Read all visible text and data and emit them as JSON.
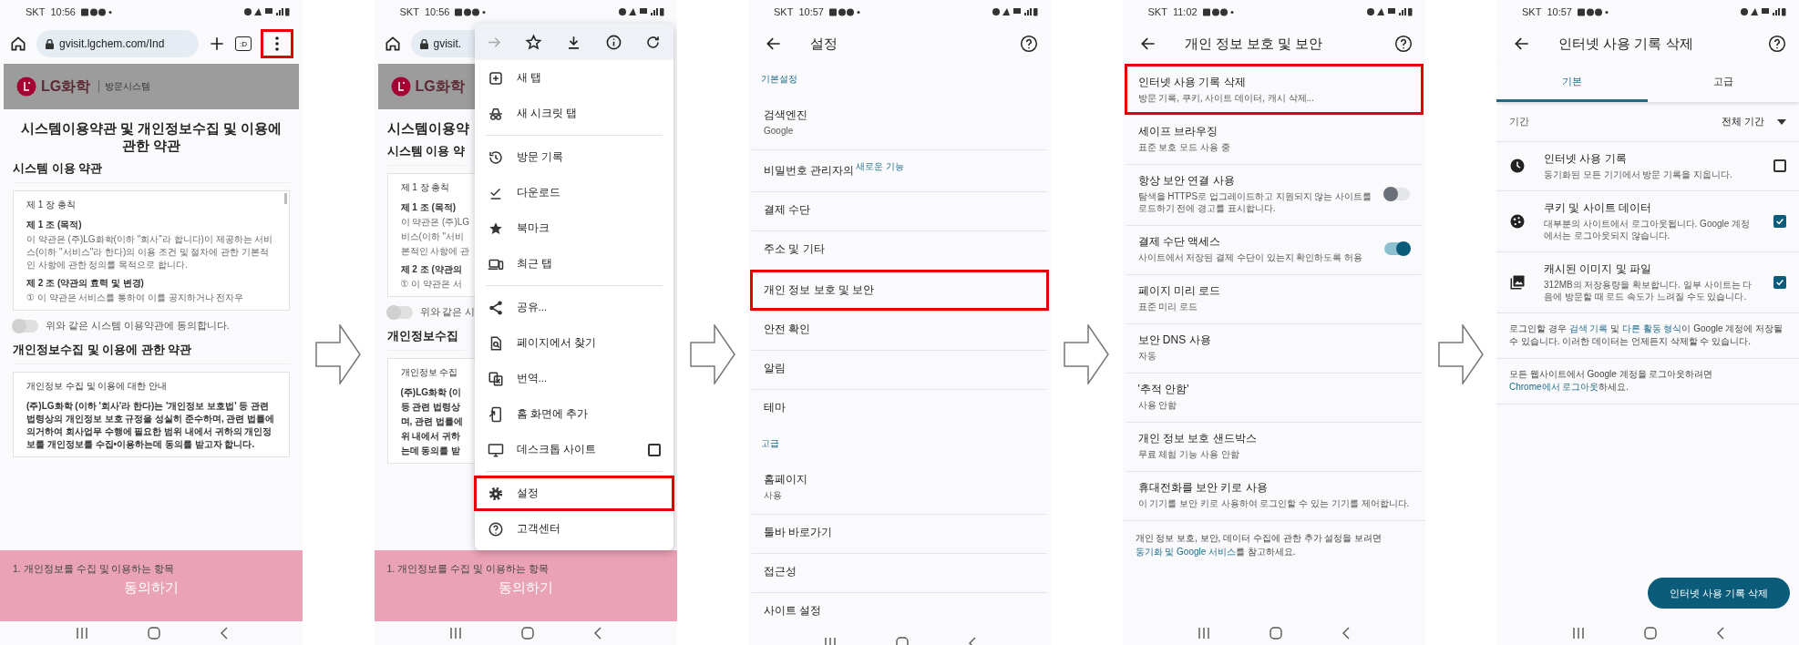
{
  "screens": {
    "web_page": {
      "carrier": "SKT",
      "time": "10:56",
      "url": "gvisit.lgchem.com/Ind",
      "tab_switcher": ":D",
      "menu_button_highlighted": true,
      "logo": "LG화학",
      "system_name": "방문시스템",
      "title": "시스템이용약관 및 개인정보수집 및 이용에 관한 약관",
      "section": "시스템 이용 약관",
      "terms_box": [
        {
          "kind": "heading",
          "text": "제 1 장 총칙"
        },
        {
          "kind": "bold",
          "text": "제 1 조 (목적)"
        },
        {
          "kind": "text",
          "text": "이 약관은 (주)LG화학(이하 \"회사\"라 합니다)이 제공하는 서비스(이하 \"서비스\"라 한다)의 이용 조건 및 절차에 관한 기본적인 사항에 관한 정의를 목적으로 합니다."
        },
        {
          "kind": "bold",
          "text": "제 2 조 (약관의 효력 및 변경)"
        },
        {
          "kind": "text",
          "text": "① 이 약관은 서비스를 통하여 이를 공지하거나 전자우"
        }
      ],
      "agree_toggle": {
        "label": "위와 같은 시스템 이용약관에 동의합니다.",
        "on": false
      },
      "section_2": "개인정보수집 및 이용에 관한 약관",
      "privacy_box": [
        {
          "kind": "heading",
          "text": "개인정보 수집 및 이용에 대한 안내"
        },
        {
          "kind": "strong",
          "text": "(주)LG화학 (이하 '회사'라 한다)는 '개인정보 보호법' 등 관련 법령상의 개인정보 보호 규정을 성실히 준수하며, 관련 법률에 의거하여 회사업무 수행에 필요한 범위 내에서 귀하의 개인정보를 개인정보를 수집•이용하는데 동의를 받고자 합니다."
        }
      ],
      "item_under_bar": "1. 개인정보를 수집 및 이용하는 항목",
      "agree_button": "동의하기"
    },
    "chrome_menu": {
      "carrier": "SKT",
      "time": "10:56",
      "page_behind": {
        "url": "gvisit.",
        "logo": "LG화학",
        "title": "시스템이용약",
        "section": "시스템 이용 약",
        "terms_box": [
          {
            "kind": "heading",
            "text": "제 1 장 총칙"
          },
          {
            "kind": "bold",
            "text": "제 1 조 (목적)"
          },
          {
            "kind": "text",
            "text": "이 약관은 (주)LG"
          },
          {
            "kind": "text",
            "text": "비스(이하 \"서비"
          },
          {
            "kind": "text",
            "text": "본적인 사항에 관"
          },
          {
            "kind": "bold",
            "text": "제 2 조 (약관의"
          },
          {
            "kind": "text",
            "text": "① 이 약관은 서"
          }
        ],
        "agree_toggle": {
          "label": "위와 같은 시",
          "on": false
        },
        "section_2": "개인정보수집",
        "privacy_box": [
          {
            "kind": "heading",
            "text": "개인정보 수집"
          },
          {
            "kind": "strong",
            "text": "(주)LG화학 (이"
          },
          {
            "kind": "strong",
            "text": "등 관련 법령상"
          },
          {
            "kind": "strong",
            "text": "며, 관련 법률에"
          },
          {
            "kind": "strong",
            "text": "위 내에서 귀하"
          },
          {
            "kind": "strong",
            "text": "는데 동의를 받"
          }
        ],
        "item_under_bar": "1. 개인정보를 수집 및 이용하는 항목",
        "agree_button": "동의하기"
      },
      "toolbar": [
        {
          "kind": "forward",
          "disabled": true
        },
        {
          "kind": "star",
          "disabled": false
        },
        {
          "kind": "download",
          "disabled": false
        },
        {
          "kind": "info",
          "disabled": false
        },
        {
          "kind": "refresh",
          "disabled": false
        }
      ],
      "groups": [
        [
          {
            "kind": "new-tab",
            "label": "새 탭",
            "highlighted": false
          },
          {
            "kind": "incognito",
            "label": "새 시크릿 탭",
            "highlighted": false
          }
        ],
        [
          {
            "kind": "history",
            "label": "방문 기록",
            "highlighted": false
          },
          {
            "kind": "downloads",
            "label": "다운로드",
            "highlighted": false
          },
          {
            "kind": "bookmarks",
            "label": "북마크",
            "highlighted": false
          },
          {
            "kind": "recent-tabs",
            "label": "최근 탭",
            "highlighted": false
          }
        ],
        [
          {
            "kind": "share",
            "label": "공유...",
            "highlighted": false
          },
          {
            "kind": "find",
            "label": "페이지에서 찾기",
            "highlighted": false
          },
          {
            "kind": "translate",
            "label": "번역...",
            "highlighted": false
          },
          {
            "kind": "add-home",
            "label": "홈 화면에 추가",
            "highlighted": false
          },
          {
            "kind": "desktop",
            "label": "데스크톱 사이트",
            "highlighted": false,
            "checked": false
          }
        ],
        [
          {
            "kind": "settings",
            "label": "설정",
            "highlighted": true
          },
          {
            "kind": "help",
            "label": "고객센터",
            "highlighted": false
          }
        ]
      ]
    },
    "settings": {
      "carrier": "SKT",
      "time": "10:57",
      "title": "설정",
      "rows": [
        {
          "kind": "section",
          "title": "기본설정"
        },
        {
          "kind": "item",
          "title": "검색엔진",
          "subtitle": "Google",
          "highlighted": false
        },
        {
          "kind": "item",
          "title": "비밀번호 관리자의",
          "badge": "새로운 기능",
          "highlighted": false
        },
        {
          "kind": "item",
          "title": "결제 수단",
          "highlighted": false
        },
        {
          "kind": "item",
          "title": "주소 및 기타",
          "highlighted": false
        },
        {
          "kind": "item",
          "title": "개인 정보 보호 및 보안",
          "highlighted": true
        },
        {
          "kind": "item",
          "title": "안전 확인",
          "highlighted": false
        },
        {
          "kind": "item",
          "title": "알림",
          "highlighted": false
        },
        {
          "kind": "item",
          "title": "테마",
          "highlighted": false
        },
        {
          "kind": "section",
          "title": "고급"
        },
        {
          "kind": "item",
          "title": "홈페이지",
          "subtitle": "사용",
          "highlighted": false
        },
        {
          "kind": "item",
          "title": "툴바 바로가기",
          "highlighted": false
        },
        {
          "kind": "item",
          "title": "접근성",
          "highlighted": false
        },
        {
          "kind": "item",
          "title": "사이트 설정",
          "highlighted": false
        }
      ]
    },
    "privacy_security": {
      "carrier": "SKT",
      "time": "11:02",
      "title": "개인 정보 보호 및 보안",
      "rows": [
        {
          "kind": "link",
          "title": "인터넷 사용 기록 삭제",
          "subtitle": "방문 기록, 쿠키, 사이트 데이터, 캐시 삭제...",
          "highlighted": true
        },
        {
          "kind": "link",
          "title": "세이프 브라우징",
          "subtitle": "표준 보호 모드 사용 중",
          "highlighted": false
        },
        {
          "kind": "switch",
          "title": "항상 보안 연결 사용",
          "subtitle": "탐색을 HTTPS로 업그레이드하고 지원되지 않는 사이트를 로드하기 전에 경고를 표시합니다.",
          "highlighted": false,
          "on": false
        },
        {
          "kind": "switch",
          "title": "결제 수단 액세스",
          "subtitle": "사이트에서 저장된 결제 수단이 있는지 확인하도록 허용",
          "highlighted": false,
          "on": true
        },
        {
          "kind": "link",
          "title": "페이지 미리 로드",
          "subtitle": "표준 미리 로드",
          "highlighted": false
        },
        {
          "kind": "link",
          "title": "보안 DNS 사용",
          "subtitle": "자동",
          "highlighted": false
        },
        {
          "kind": "link",
          "title": "'추적 안함'",
          "subtitle": "사용 안함",
          "highlighted": false
        },
        {
          "kind": "link",
          "title": "개인 정보 보호 샌드박스",
          "subtitle": "무료 체험 기능 사용 안함",
          "highlighted": false
        },
        {
          "kind": "link",
          "title": "휴대전화를 보안 키로 사용",
          "subtitle": "이 기기를 보안 키로 사용하여 로그인할 수 있는 기기를 제어합니다.",
          "highlighted": false
        }
      ],
      "footer": [
        {
          "text": "개인 정보 보호, 보안, 데이터 수집에 관한 추가 설정을 보려면 ",
          "link": false
        },
        {
          "text": "동기화 및 Google 서비스",
          "link": true
        },
        {
          "text": "를 참고하세요.",
          "link": false
        }
      ]
    },
    "clear_browsing_data": {
      "carrier": "SKT",
      "time": "10:57",
      "title": "인터넷 사용 기록 삭제",
      "tabs": [
        {
          "label": "기본",
          "selected": true
        },
        {
          "label": "고급",
          "selected": false
        }
      ],
      "time_range": {
        "label": "기간",
        "value": "전체 기간"
      },
      "options": [
        {
          "kind": "clock",
          "title": "인터넷 사용 기록",
          "description": "동기화된 모든 기기에서 방문 기록을 지웁니다.",
          "checked": false
        },
        {
          "kind": "cookie",
          "title": "쿠키 및 사이트 데이터",
          "description": "대부분의 사이트에서 로그아웃됩니다. Google 계정에서는 로그아웃되지 않습니다.",
          "checked": true
        },
        {
          "kind": "image",
          "title": "캐시된 이미지 및 파일",
          "description": "312MB의 저장용량을 확보합니다. 일부 사이트는 다음에 방문할 때 로드 속도가 느려질 수도 있습니다.",
          "checked": true
        }
      ],
      "notes": [
        [
          {
            "text": "로그인할 경우 ",
            "link": false
          },
          {
            "text": "검색 기록",
            "link": true
          },
          {
            "text": " 및 ",
            "link": false
          },
          {
            "text": "다른 활동 형식",
            "link": true
          },
          {
            "text": "이 Google 계정에 저장될 수 있습니다. 이러한 데이터는 언제든지 삭제할 수 있습니다.",
            "link": false
          }
        ],
        [
          {
            "text": "모든 웹사이트에서 Google 계정을 로그아웃하려면 ",
            "link": false
          },
          {
            "text": "Chrome에서 로그아웃",
            "link": true
          },
          {
            "text": "하세요.",
            "link": false
          }
        ]
      ],
      "button": "인터넷 사용 기록 삭제"
    }
  }
}
